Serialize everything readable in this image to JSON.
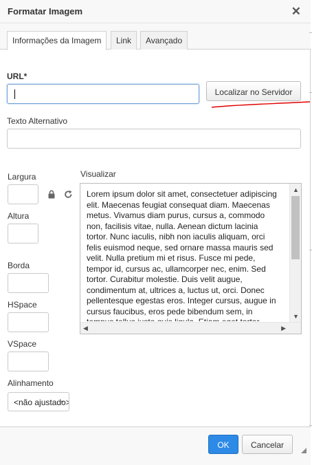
{
  "dialog": {
    "title": "Formatar Imagem",
    "close_icon": "close-icon"
  },
  "tabs": [
    {
      "label": "Informações da Imagem",
      "active": true
    },
    {
      "label": "Link",
      "active": false
    },
    {
      "label": "Avançado",
      "active": false
    }
  ],
  "url": {
    "label": "URL*",
    "value": "",
    "browse_button": "Localizar no Servidor"
  },
  "alt_text": {
    "label": "Texto Alternativo",
    "value": ""
  },
  "dimensions": {
    "width_label": "Largura",
    "height_label": "Altura",
    "width_value": "",
    "height_value": "",
    "lock_icon": "lock-icon",
    "reset_icon": "reset-size-icon"
  },
  "border": {
    "label": "Borda",
    "value": ""
  },
  "hspace": {
    "label": "HSpace",
    "value": ""
  },
  "vspace": {
    "label": "VSpace",
    "value": ""
  },
  "alignment": {
    "label": "Alinhamento",
    "selected": "<não ajustado>"
  },
  "preview": {
    "label": "Visualizar",
    "text": "Lorem ipsum dolor sit amet, consectetuer adipiscing elit. Maecenas feugiat consequat diam. Maecenas metus. Vivamus diam purus, cursus a, commodo non, facilisis vitae, nulla. Aenean dictum lacinia tortor. Nunc iaculis, nibh non iaculis aliquam, orci felis euismod neque, sed ornare massa mauris sed velit. Nulla pretium mi et risus. Fusce mi pede, tempor id, cursus ac, ullamcorper nec, enim. Sed tortor. Curabitur molestie. Duis velit augue, condimentum at, ultrices a, luctus ut, orci. Donec pellentesque egestas eros. Integer cursus, augue in cursus faucibus, eros pede bibendum sem, in tempus tellus justo quis ligula. Etiam eget tortor."
  },
  "footer": {
    "ok": "OK",
    "cancel": "Cancelar"
  },
  "annotation_color": "#e00000"
}
